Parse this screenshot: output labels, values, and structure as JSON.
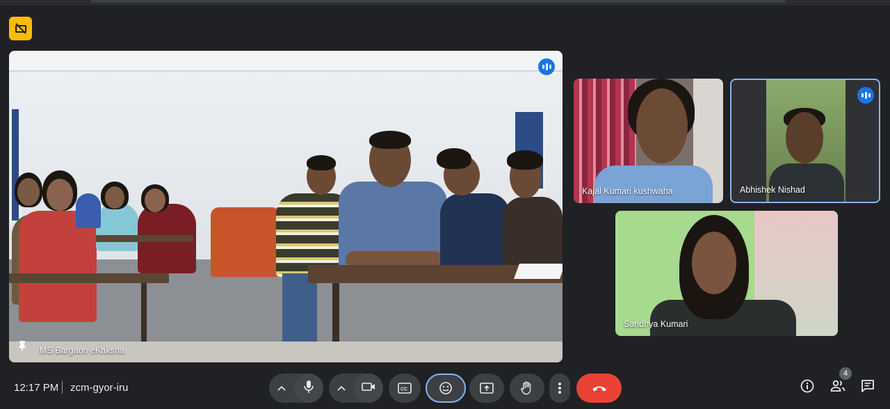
{
  "meeting": {
    "time": "12:17 PM",
    "code": "zcm-gyor-iru",
    "participant_count": "4"
  },
  "participants": [
    {
      "name": "MS Bargaon eKaksha",
      "pinned": true,
      "speaking": true
    },
    {
      "name": "Kajal Kumari kushwaha",
      "speaking": false
    },
    {
      "name": "Abhishek Nishad",
      "speaking": true
    },
    {
      "name": "Sandhya Kumari",
      "speaking": false
    }
  ],
  "icons": {
    "top_left_badge": "no-signal-icon",
    "pin": "pin-icon",
    "speaking": "audio-level-icon",
    "mic": "mic-icon",
    "camera": "camera-icon",
    "captions": "captions-icon",
    "reactions": "emoji-icon",
    "present": "present-screen-icon",
    "hand": "raise-hand-icon",
    "more": "more-vert-icon",
    "hangup": "hang-up-icon",
    "info": "info-icon",
    "people": "people-icon",
    "chat": "chat-icon"
  },
  "colors": {
    "background": "#202124",
    "control": "#3c4043",
    "end_call": "#ea4335",
    "accent": "#8ab4f8",
    "badge": "#fbbc04",
    "speaking_badge": "#1a73e8"
  }
}
